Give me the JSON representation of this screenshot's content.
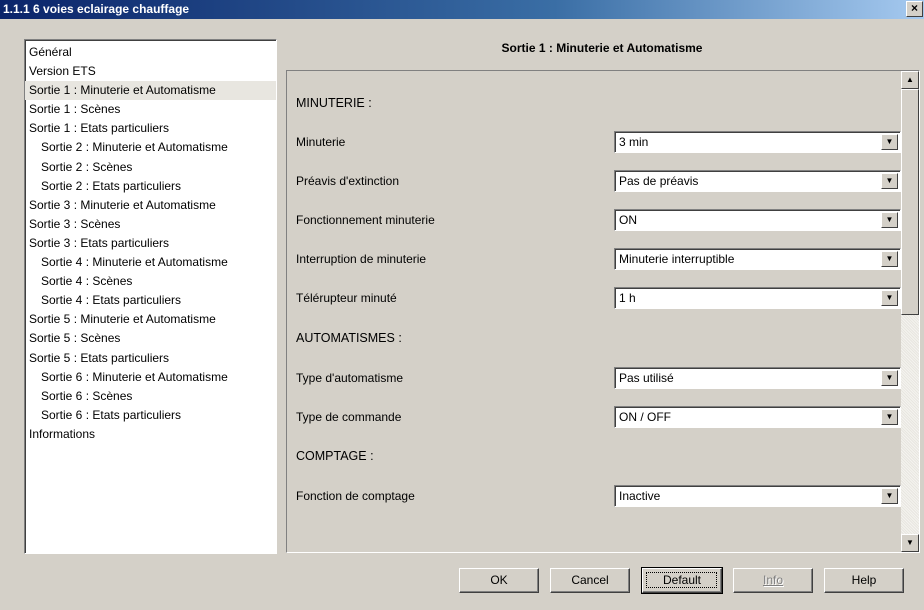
{
  "window": {
    "title": "1.1.1 6 voies eclairage chauffage",
    "close_label": "×"
  },
  "tree": {
    "items": [
      {
        "label": "Général"
      },
      {
        "label": "Version ETS"
      },
      {
        "label": "Sortie 1 : Minuterie et Automatisme"
      },
      {
        "label": "Sortie 1 : Scènes"
      },
      {
        "label": "Sortie 1 : Etats particuliers"
      },
      {
        "label": "Sortie 2 : Minuterie et Automatisme"
      },
      {
        "label": "Sortie 2 : Scènes"
      },
      {
        "label": "Sortie 2 : Etats particuliers"
      },
      {
        "label": "Sortie 3 : Minuterie et Automatisme"
      },
      {
        "label": "Sortie 3 : Scènes"
      },
      {
        "label": "Sortie 3 : Etats particuliers"
      },
      {
        "label": "Sortie 4 : Minuterie et Automatisme"
      },
      {
        "label": "Sortie 4 : Scènes"
      },
      {
        "label": "Sortie 4 : Etats particuliers"
      },
      {
        "label": "Sortie 5 : Minuterie et Automatisme"
      },
      {
        "label": "Sortie 5 : Scènes"
      },
      {
        "label": "Sortie 5 : Etats particuliers"
      },
      {
        "label": "Sortie 6 : Minuterie et Automatisme"
      },
      {
        "label": "Sortie 6 : Scènes"
      },
      {
        "label": "Sortie 6 : Etats particuliers"
      },
      {
        "label": "Informations"
      }
    ]
  },
  "panel": {
    "title": "Sortie 1 : Minuterie et Automatisme",
    "sections": {
      "minuterie": "MINUTERIE :",
      "automatismes": "AUTOMATISMES :",
      "comptage": "COMPTAGE :"
    },
    "params": {
      "minuterie": {
        "label": "Minuterie",
        "value": "3 min"
      },
      "preavis": {
        "label": "Préavis d'extinction",
        "value": "Pas de préavis"
      },
      "fonctionnement": {
        "label": "Fonctionnement minuterie",
        "value": "ON"
      },
      "interruption": {
        "label": "Interruption de minuterie",
        "value": "Minuterie interruptible"
      },
      "telerupteur": {
        "label": "Télérupteur minuté",
        "value": "1 h"
      },
      "type_automatisme": {
        "label": "Type d'automatisme",
        "value": "Pas utilisé"
      },
      "type_commande": {
        "label": "Type de commande",
        "value": "ON / OFF"
      },
      "fonction_comptage": {
        "label": "Fonction de comptage",
        "value": "Inactive"
      }
    },
    "scroll_up": "▲",
    "scroll_down": "▼"
  },
  "buttons": {
    "ok": "OK",
    "cancel": "Cancel",
    "default": "Default",
    "info": "Info",
    "help": "Help"
  },
  "dropdown_arrow": "▼",
  "colors": {
    "titlebar_start": "#0a246a",
    "titlebar_end": "#a6caf0",
    "dialog_bg": "#d4d0c8",
    "selected_item": "#e8e6e0"
  }
}
